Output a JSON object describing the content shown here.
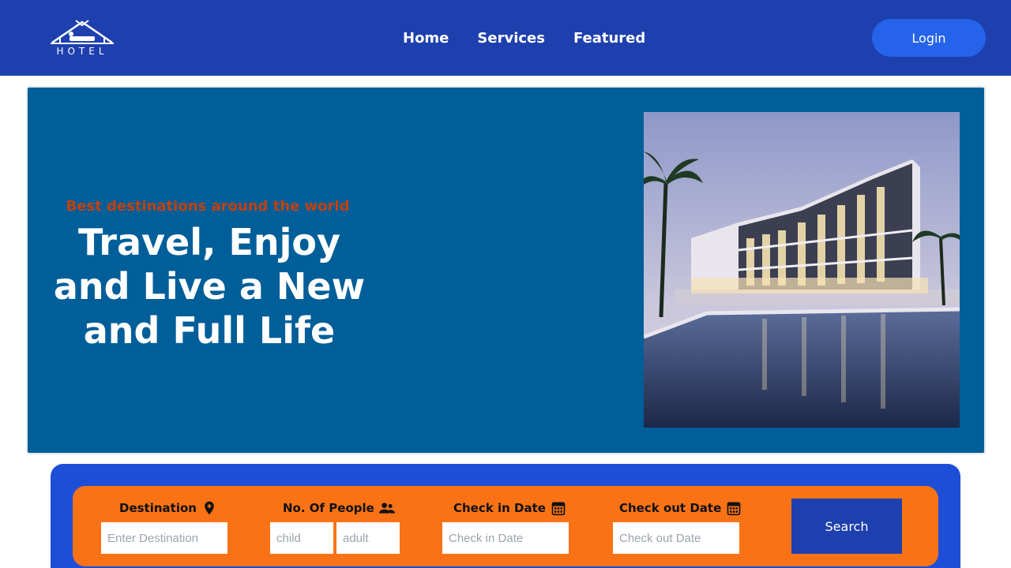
{
  "header": {
    "logo_text": "HOTEL",
    "nav": [
      "Home",
      "Services",
      "Featured"
    ],
    "login_label": "Login"
  },
  "hero": {
    "subtitle": "Best destinations around the world",
    "title": "Travel, Enjoy and Live a New and Full Life"
  },
  "search": {
    "destination_label": "Destination",
    "destination_placeholder": "Enter Destination",
    "people_label": "No. Of People",
    "child_placeholder": "child",
    "adult_placeholder": "adult",
    "checkin_label": "Check in Date",
    "checkin_placeholder": "Check in Date",
    "checkout_label": "Check out Date",
    "checkout_placeholder": "Check out Date",
    "search_label": "Search"
  },
  "colors": {
    "header": "#1e40af",
    "hero": "#005e99",
    "accent": "#c2410c",
    "search_bar": "#f97316",
    "search_panel": "#1d4ed8"
  }
}
